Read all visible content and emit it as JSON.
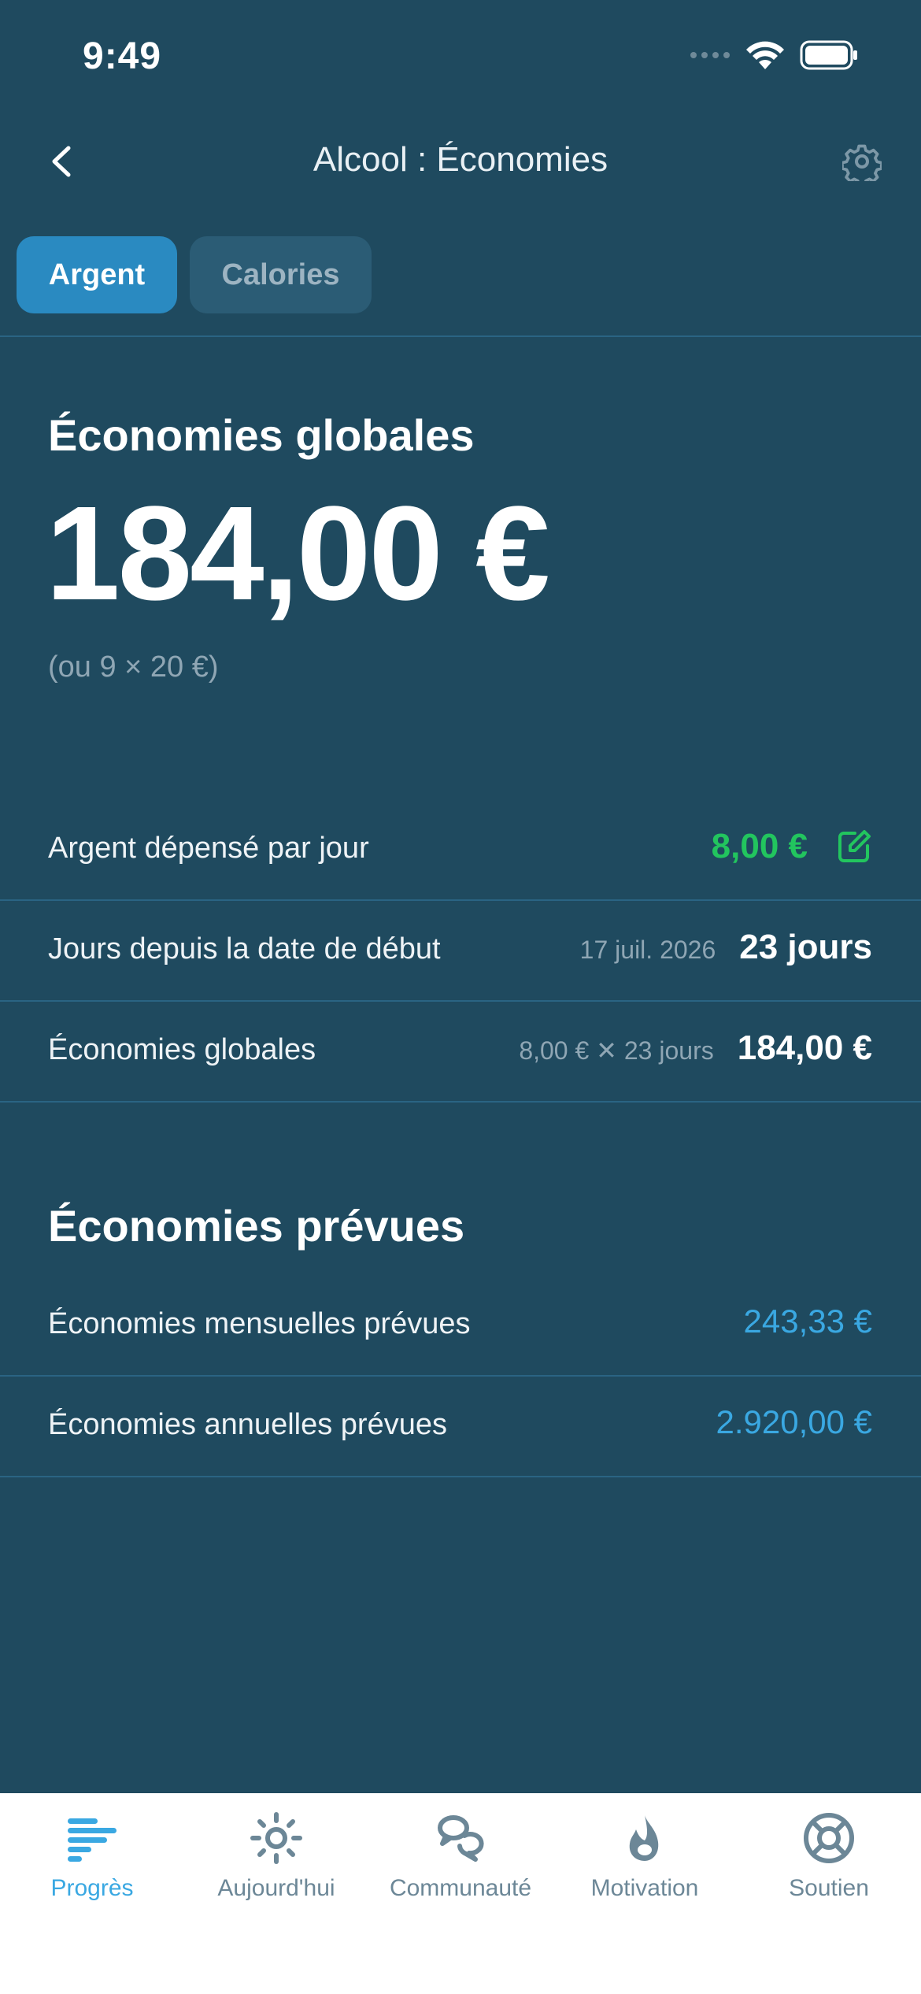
{
  "status_bar": {
    "time": "9:49"
  },
  "header": {
    "title": "Alcool : Économies"
  },
  "segments": [
    {
      "label": "Argent",
      "selected": true
    },
    {
      "label": "Calories",
      "selected": false
    }
  ],
  "global": {
    "heading": "Économies globales",
    "amount": "184,00 €",
    "sub": "(ou 9 × 20 €)"
  },
  "rows": [
    {
      "label": "Argent dépensé par jour",
      "value": "8,00 €"
    },
    {
      "label": "Jours depuis la date de début",
      "detail": "17 juil. 2026",
      "value": "23 jours"
    },
    {
      "label": "Économies globales",
      "detail": "8,00 € ✕ 23 jours",
      "value": "184,00 €"
    }
  ],
  "prevues": {
    "heading": "Économies prévues",
    "rows": [
      {
        "label": "Économies mensuelles prévues",
        "value": "243,33 €"
      },
      {
        "label": "Économies annuelles prévues",
        "value": "2.920,00 €"
      }
    ]
  },
  "tabbar": [
    {
      "label": "Progrès",
      "icon": "progress-icon",
      "active": true
    },
    {
      "label": "Aujourd'hui",
      "icon": "sun-icon",
      "active": false
    },
    {
      "label": "Communauté",
      "icon": "chat-bubbles-icon",
      "active": false
    },
    {
      "label": "Motivation",
      "icon": "flame-icon",
      "active": false
    },
    {
      "label": "Soutien",
      "icon": "lifebuoy-icon",
      "active": false
    }
  ],
  "colors": {
    "background": "#1f4a5f",
    "accent": "#2a8ac1",
    "green": "#22c55e",
    "blue": "#3aa8e2"
  }
}
